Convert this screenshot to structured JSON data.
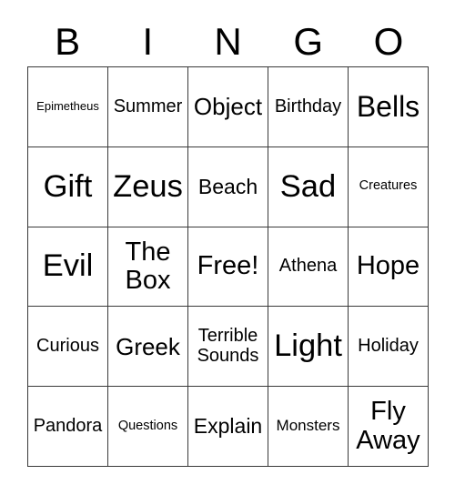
{
  "card": {
    "header": {
      "letters": [
        "B",
        "I",
        "N",
        "G",
        "O"
      ]
    },
    "colors": {
      "text": "#000000",
      "border": "#3a3a3a",
      "background": "#ffffff"
    },
    "grid": {
      "columns": 5,
      "rows": 5,
      "cells": [
        {
          "label": "Epimetheus",
          "size": "xs"
        },
        {
          "label": "Summer",
          "size": "m"
        },
        {
          "label": "Object",
          "size": "l"
        },
        {
          "label": "Birthday",
          "size": "m"
        },
        {
          "label": "Bells",
          "size": "xxl"
        },
        {
          "label": "Gift",
          "size": "3xl"
        },
        {
          "label": "Zeus",
          "size": "3xl"
        },
        {
          "label": "Beach",
          "size": "ml"
        },
        {
          "label": "Sad",
          "size": "3xl"
        },
        {
          "label": "Creatures",
          "size": "s"
        },
        {
          "label": "Evil",
          "size": "3xl"
        },
        {
          "label": "The Box",
          "size": "xl"
        },
        {
          "label": "Free!",
          "size": "xl"
        },
        {
          "label": "Athena",
          "size": "m"
        },
        {
          "label": "Hope",
          "size": "xl"
        },
        {
          "label": "Curious",
          "size": "m"
        },
        {
          "label": "Greek",
          "size": "l"
        },
        {
          "label": "Terrible Sounds",
          "size": "m"
        },
        {
          "label": "Light",
          "size": "3xl"
        },
        {
          "label": "Holiday",
          "size": "m"
        },
        {
          "label": "Pandora",
          "size": "m"
        },
        {
          "label": "Questions",
          "size": "s"
        },
        {
          "label": "Explain",
          "size": "ml"
        },
        {
          "label": "Monsters",
          "size": "sm"
        },
        {
          "label": "Fly Away",
          "size": "xl"
        }
      ]
    }
  }
}
